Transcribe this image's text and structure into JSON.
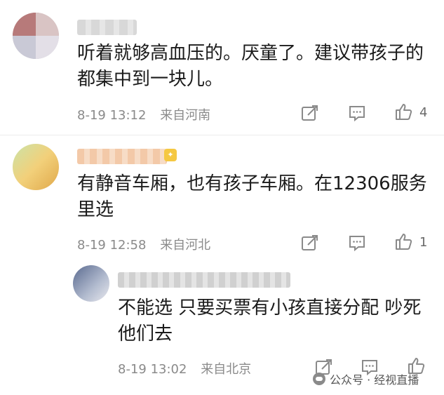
{
  "comments": [
    {
      "text": "听着就够高血压的。厌童了。建议带孩子的都集中到一块儿。",
      "date": "8-19 13:12",
      "location": "来自河南",
      "likes": "4"
    },
    {
      "text": "有静音车厢，也有孩子车厢。在12306服务里选",
      "date": "8-19 12:58",
      "location": "来自河北",
      "likes": "1"
    },
    {
      "text": "不能选 只要买票有小孩直接分配 吵死他们去",
      "date": "8-19 13:02",
      "location": "来自北京"
    }
  ],
  "watermark": "公众号 · 经视直播",
  "icons": [
    "share-icon",
    "reply-icon",
    "like-icon"
  ],
  "colors": {
    "meta_text": "#8a8a8a",
    "body_text": "#1b1b1b"
  }
}
